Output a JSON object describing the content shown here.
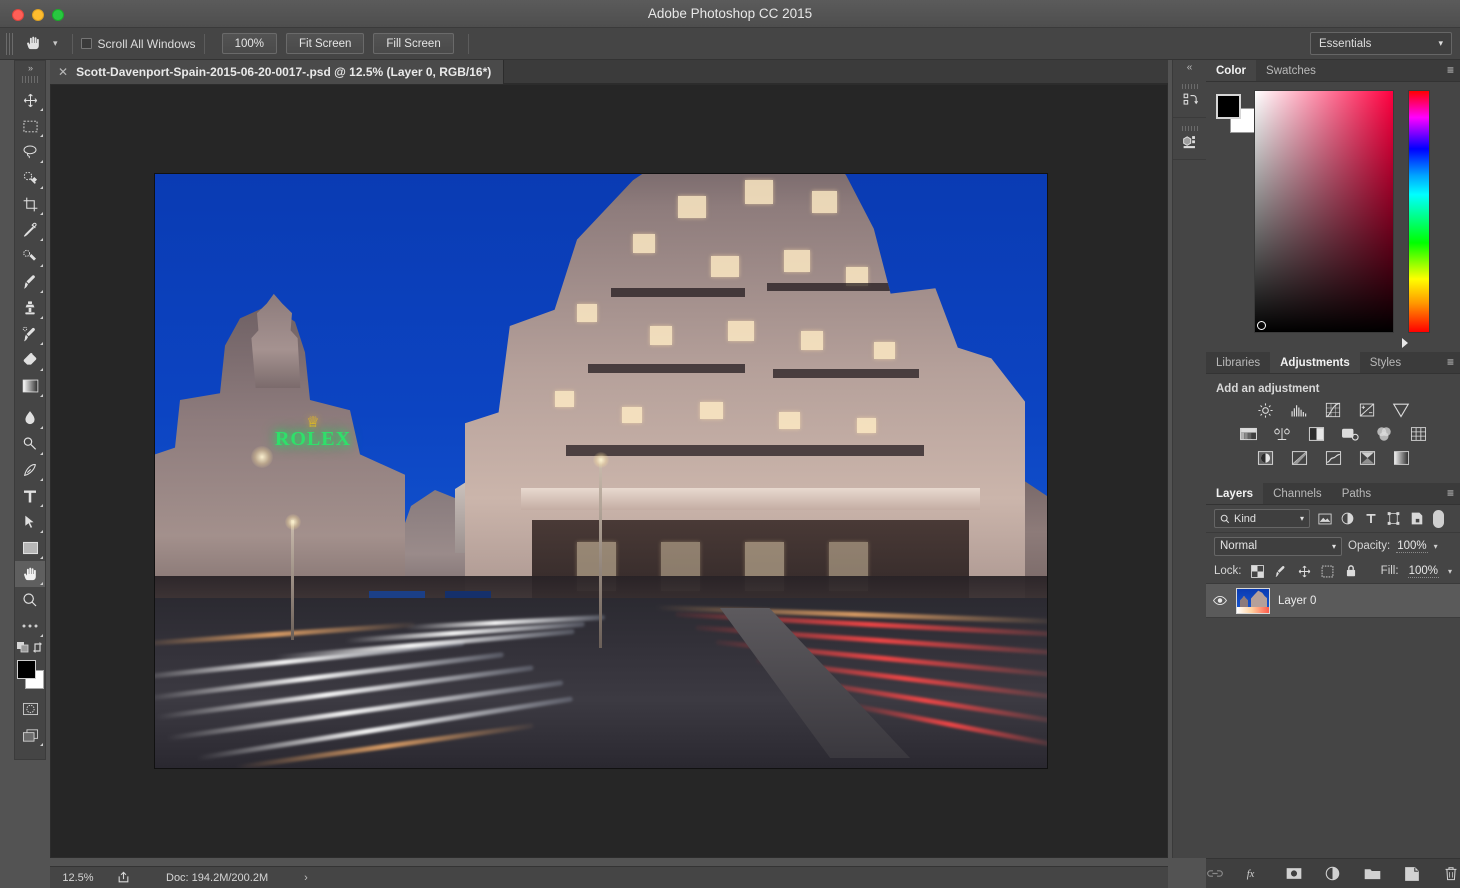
{
  "window": {
    "title": "Adobe Photoshop CC 2015",
    "traffic_lights": [
      "close",
      "minimize",
      "maximize"
    ]
  },
  "options_bar": {
    "tool_icon": "hand-tool-icon",
    "preset_chevron": "chevron-down-icon",
    "scroll_all_windows_label": "Scroll All Windows",
    "scroll_all_windows_checked": false,
    "buttons": [
      {
        "label": "100%",
        "name": "zoom-100-button"
      },
      {
        "label": "Fit Screen",
        "name": "fit-screen-button"
      },
      {
        "label": "Fill Screen",
        "name": "fill-screen-button"
      }
    ],
    "workspace": {
      "label": "Essentials",
      "chevron": "chevron-down-icon"
    }
  },
  "toolbar": {
    "expand_label": "»",
    "tools": [
      {
        "name": "move-tool",
        "icon": "move-icon"
      },
      {
        "name": "rectangular-marquee-tool",
        "icon": "marquee-icon"
      },
      {
        "name": "lasso-tool",
        "icon": "lasso-icon"
      },
      {
        "name": "quick-selection-tool",
        "icon": "quick-select-icon"
      },
      {
        "name": "crop-tool",
        "icon": "crop-icon"
      },
      {
        "name": "eyedropper-tool",
        "icon": "eyedropper-icon"
      },
      {
        "name": "spot-healing-brush-tool",
        "icon": "healing-brush-icon"
      },
      {
        "name": "brush-tool",
        "icon": "brush-icon"
      },
      {
        "name": "clone-stamp-tool",
        "icon": "clone-stamp-icon"
      },
      {
        "name": "history-brush-tool",
        "icon": "history-brush-icon"
      },
      {
        "name": "eraser-tool",
        "icon": "eraser-icon"
      },
      {
        "name": "gradient-tool",
        "icon": "gradient-icon"
      },
      {
        "name": "blur-tool",
        "icon": "blur-droplet-icon"
      },
      {
        "name": "dodge-tool",
        "icon": "dodge-icon"
      },
      {
        "name": "pen-tool",
        "icon": "pen-icon"
      },
      {
        "name": "type-tool",
        "icon": "type-t-icon"
      },
      {
        "name": "path-selection-tool",
        "icon": "path-arrow-icon"
      },
      {
        "name": "rectangle-tool",
        "icon": "rectangle-icon"
      },
      {
        "name": "hand-tool",
        "icon": "hand-icon",
        "selected": true
      },
      {
        "name": "zoom-tool",
        "icon": "magnifier-icon"
      },
      {
        "name": "more-tools",
        "icon": "ellipsis-icon"
      }
    ],
    "foreground_color": "#000000",
    "background_color": "#ffffff",
    "quick_mask_icon": "quick-mask-icon",
    "screen_mode_icon": "screen-mode-icon"
  },
  "document_tab": {
    "close_icon": "close-icon",
    "title": "Scott-Davenport-Spain-2015-06-20-0017-.psd @ 12.5% (Layer 0, RGB/16*)"
  },
  "canvas": {
    "image_description": "Gran Via Madrid at blue hour with light trails",
    "sky_color": "#0c44c2",
    "sign": {
      "crown": "♕",
      "text": "ROLEX",
      "text_color": "#2fe06a",
      "crown_color": "#f5c518"
    }
  },
  "status_bar": {
    "zoom": "12.5%",
    "share_icon": "share-icon",
    "doc_info": "Doc: 194.2M/200.2M",
    "chevron": "›"
  },
  "mini_dock": {
    "collapse_icon": "«",
    "items": [
      {
        "name": "history-panel-icon",
        "icon": "history-icon"
      },
      {
        "name": "3d-panel-icon",
        "icon": "cube-icon"
      }
    ]
  },
  "color_panel": {
    "tabs": [
      {
        "label": "Color",
        "active": true
      },
      {
        "label": "Swatches",
        "active": false
      }
    ],
    "menu_icon": "panel-menu-icon",
    "foreground_color": "#000000",
    "background_color": "#ffffff",
    "field_gradient_to": "#ff0040"
  },
  "adjustments_panel": {
    "tabs": [
      {
        "label": "Libraries",
        "active": false
      },
      {
        "label": "Adjustments",
        "active": true
      },
      {
        "label": "Styles",
        "active": false
      }
    ],
    "menu_icon": "panel-menu-icon",
    "heading": "Add an adjustment",
    "rows": [
      [
        {
          "name": "brightness-contrast-icon"
        },
        {
          "name": "levels-icon"
        },
        {
          "name": "curves-icon"
        },
        {
          "name": "exposure-icon"
        },
        {
          "name": "vibrance-icon"
        }
      ],
      [
        {
          "name": "hue-saturation-icon"
        },
        {
          "name": "color-balance-icon"
        },
        {
          "name": "black-white-icon"
        },
        {
          "name": "photo-filter-icon"
        },
        {
          "name": "channel-mixer-icon"
        },
        {
          "name": "color-lookup-icon"
        }
      ],
      [
        {
          "name": "invert-icon"
        },
        {
          "name": "posterize-icon"
        },
        {
          "name": "threshold-icon"
        },
        {
          "name": "selective-color-icon"
        },
        {
          "name": "gradient-map-icon"
        }
      ]
    ]
  },
  "layers_panel": {
    "tabs": [
      {
        "label": "Layers",
        "active": true
      },
      {
        "label": "Channels",
        "active": false
      },
      {
        "label": "Paths",
        "active": false
      }
    ],
    "menu_icon": "panel-menu-icon",
    "filter": {
      "search_icon": "search-icon",
      "kind_label": "Kind",
      "chevron": "chevron-down-icon",
      "icons": [
        {
          "name": "filter-pixel-icon"
        },
        {
          "name": "filter-adjustment-icon"
        },
        {
          "name": "filter-type-icon"
        },
        {
          "name": "filter-shape-icon"
        },
        {
          "name": "filter-smart-object-icon"
        }
      ],
      "toggle_on": true
    },
    "blend_mode": "Normal",
    "blend_chevron": "chevron-down-icon",
    "opacity_label": "Opacity:",
    "opacity_value": "100%",
    "lock_label": "Lock:",
    "lock_icons": [
      {
        "name": "lock-transparent-pixels-icon"
      },
      {
        "name": "lock-image-pixels-icon"
      },
      {
        "name": "lock-position-icon"
      },
      {
        "name": "lock-artboard-icon"
      },
      {
        "name": "lock-all-icon"
      }
    ],
    "fill_label": "Fill:",
    "fill_value": "100%",
    "layers": [
      {
        "name": "Layer 0",
        "visible": true,
        "selected": true
      }
    ],
    "footer_icons": [
      {
        "name": "link-layers-icon",
        "enabled": false
      },
      {
        "name": "layer-style-fx-icon",
        "enabled": true
      },
      {
        "name": "add-layer-mask-icon",
        "enabled": true
      },
      {
        "name": "new-adjustment-layer-icon",
        "enabled": true
      },
      {
        "name": "new-group-icon",
        "enabled": true
      },
      {
        "name": "new-layer-icon",
        "enabled": true
      },
      {
        "name": "delete-layer-icon",
        "enabled": true
      }
    ]
  }
}
